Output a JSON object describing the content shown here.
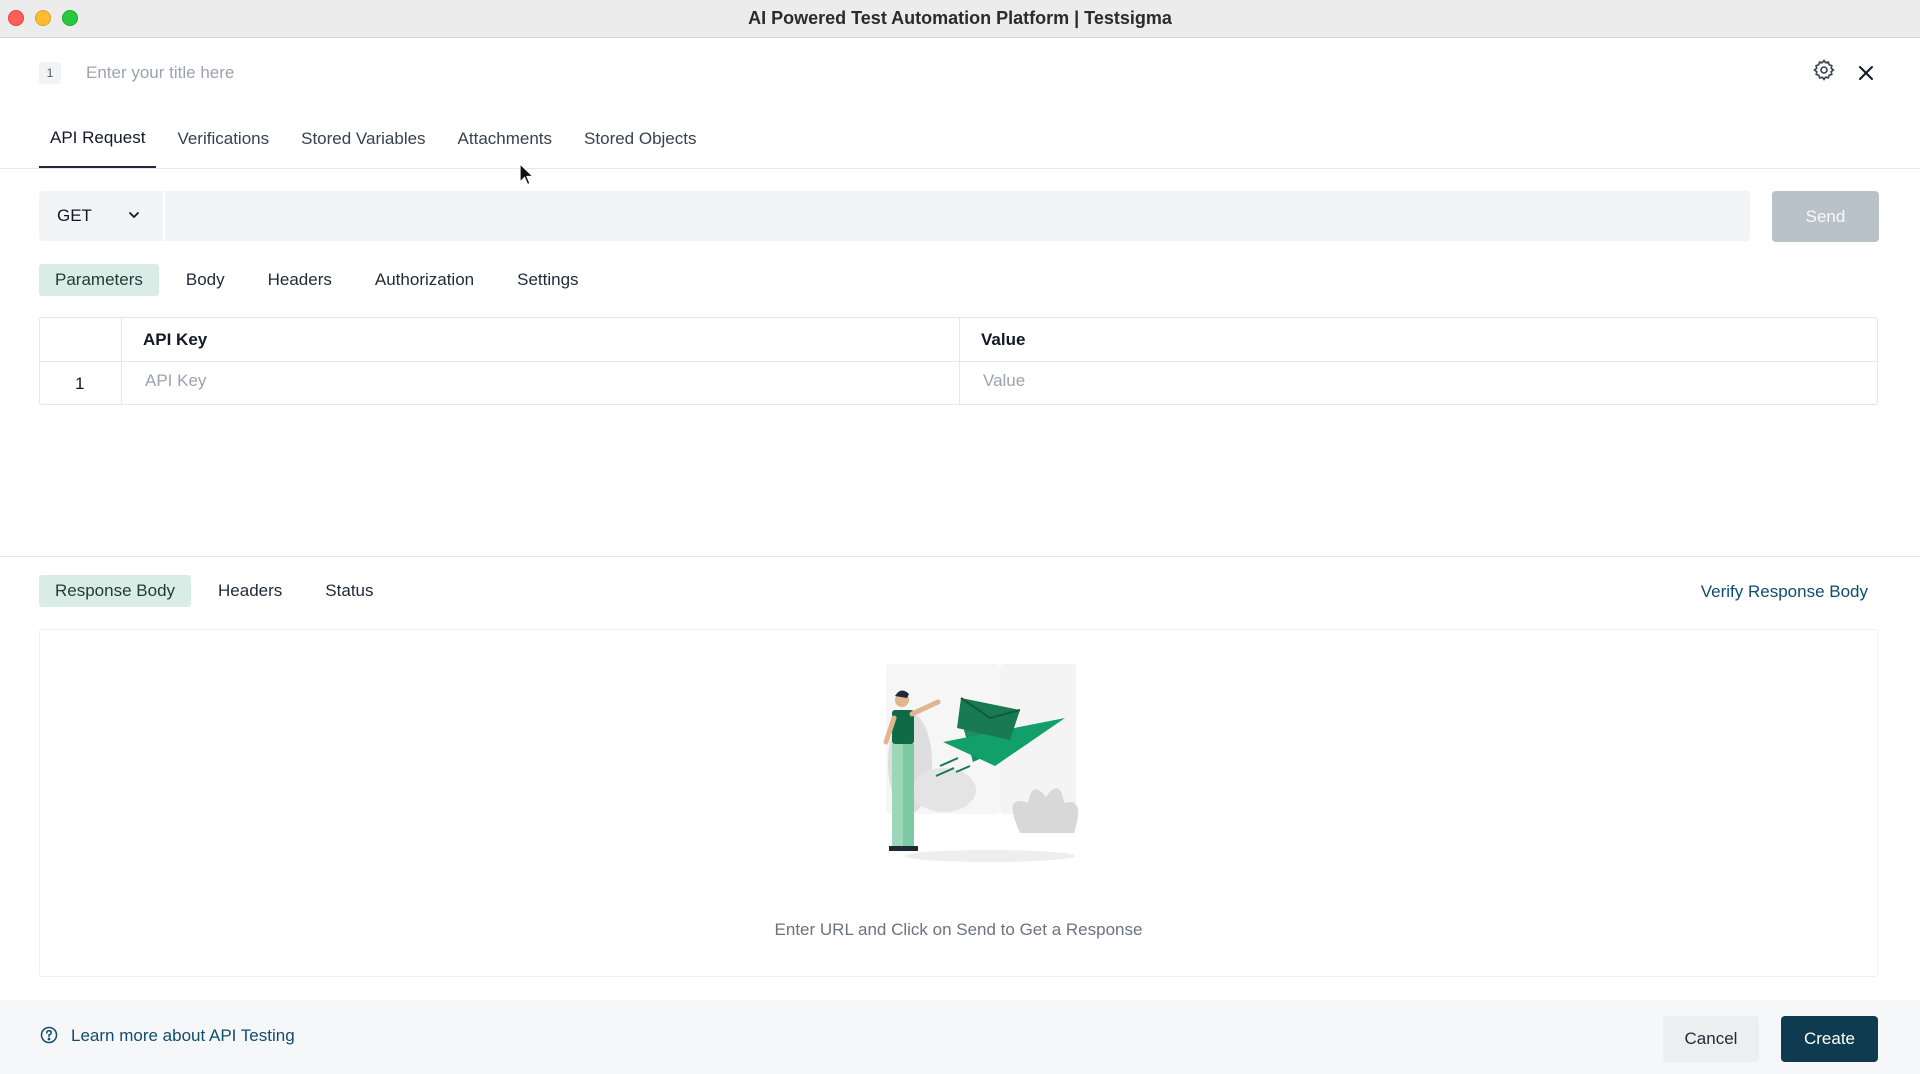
{
  "window": {
    "title": "AI Powered Test Automation Platform | Testsigma"
  },
  "header": {
    "step_number": "1",
    "title_placeholder": "Enter your title here",
    "settings_icon": "gear-icon",
    "close_icon": "close-icon"
  },
  "main_tabs": [
    {
      "label": "API Request",
      "active": true
    },
    {
      "label": "Verifications",
      "active": false
    },
    {
      "label": "Stored Variables",
      "active": false
    },
    {
      "label": "Attachments",
      "active": false
    },
    {
      "label": "Stored Objects",
      "active": false
    }
  ],
  "request": {
    "method": "GET",
    "url": "",
    "send_label": "Send"
  },
  "request_tabs": [
    {
      "label": "Parameters",
      "active": true
    },
    {
      "label": "Body",
      "active": false
    },
    {
      "label": "Headers",
      "active": false
    },
    {
      "label": "Authorization",
      "active": false
    },
    {
      "label": "Settings",
      "active": false
    }
  ],
  "params_table": {
    "columns": [
      "API Key",
      "Value"
    ],
    "rows": [
      {
        "index": "1",
        "key_placeholder": "API Key",
        "value_placeholder": "Value"
      }
    ]
  },
  "response_tabs": [
    {
      "label": "Response Body",
      "active": true
    },
    {
      "label": "Headers",
      "active": false
    },
    {
      "label": "Status",
      "active": false
    }
  ],
  "response": {
    "verify_link": "Verify Response Body",
    "empty_message": "Enter URL and Click on Send to Get a Response"
  },
  "footer": {
    "help_link": "Learn more about API Testing",
    "cancel_label": "Cancel",
    "create_label": "Create"
  },
  "colors": {
    "accent": "#0e3b4f",
    "active_tab_bg": "#d9ede6",
    "illustration_green": "#12a06a"
  }
}
